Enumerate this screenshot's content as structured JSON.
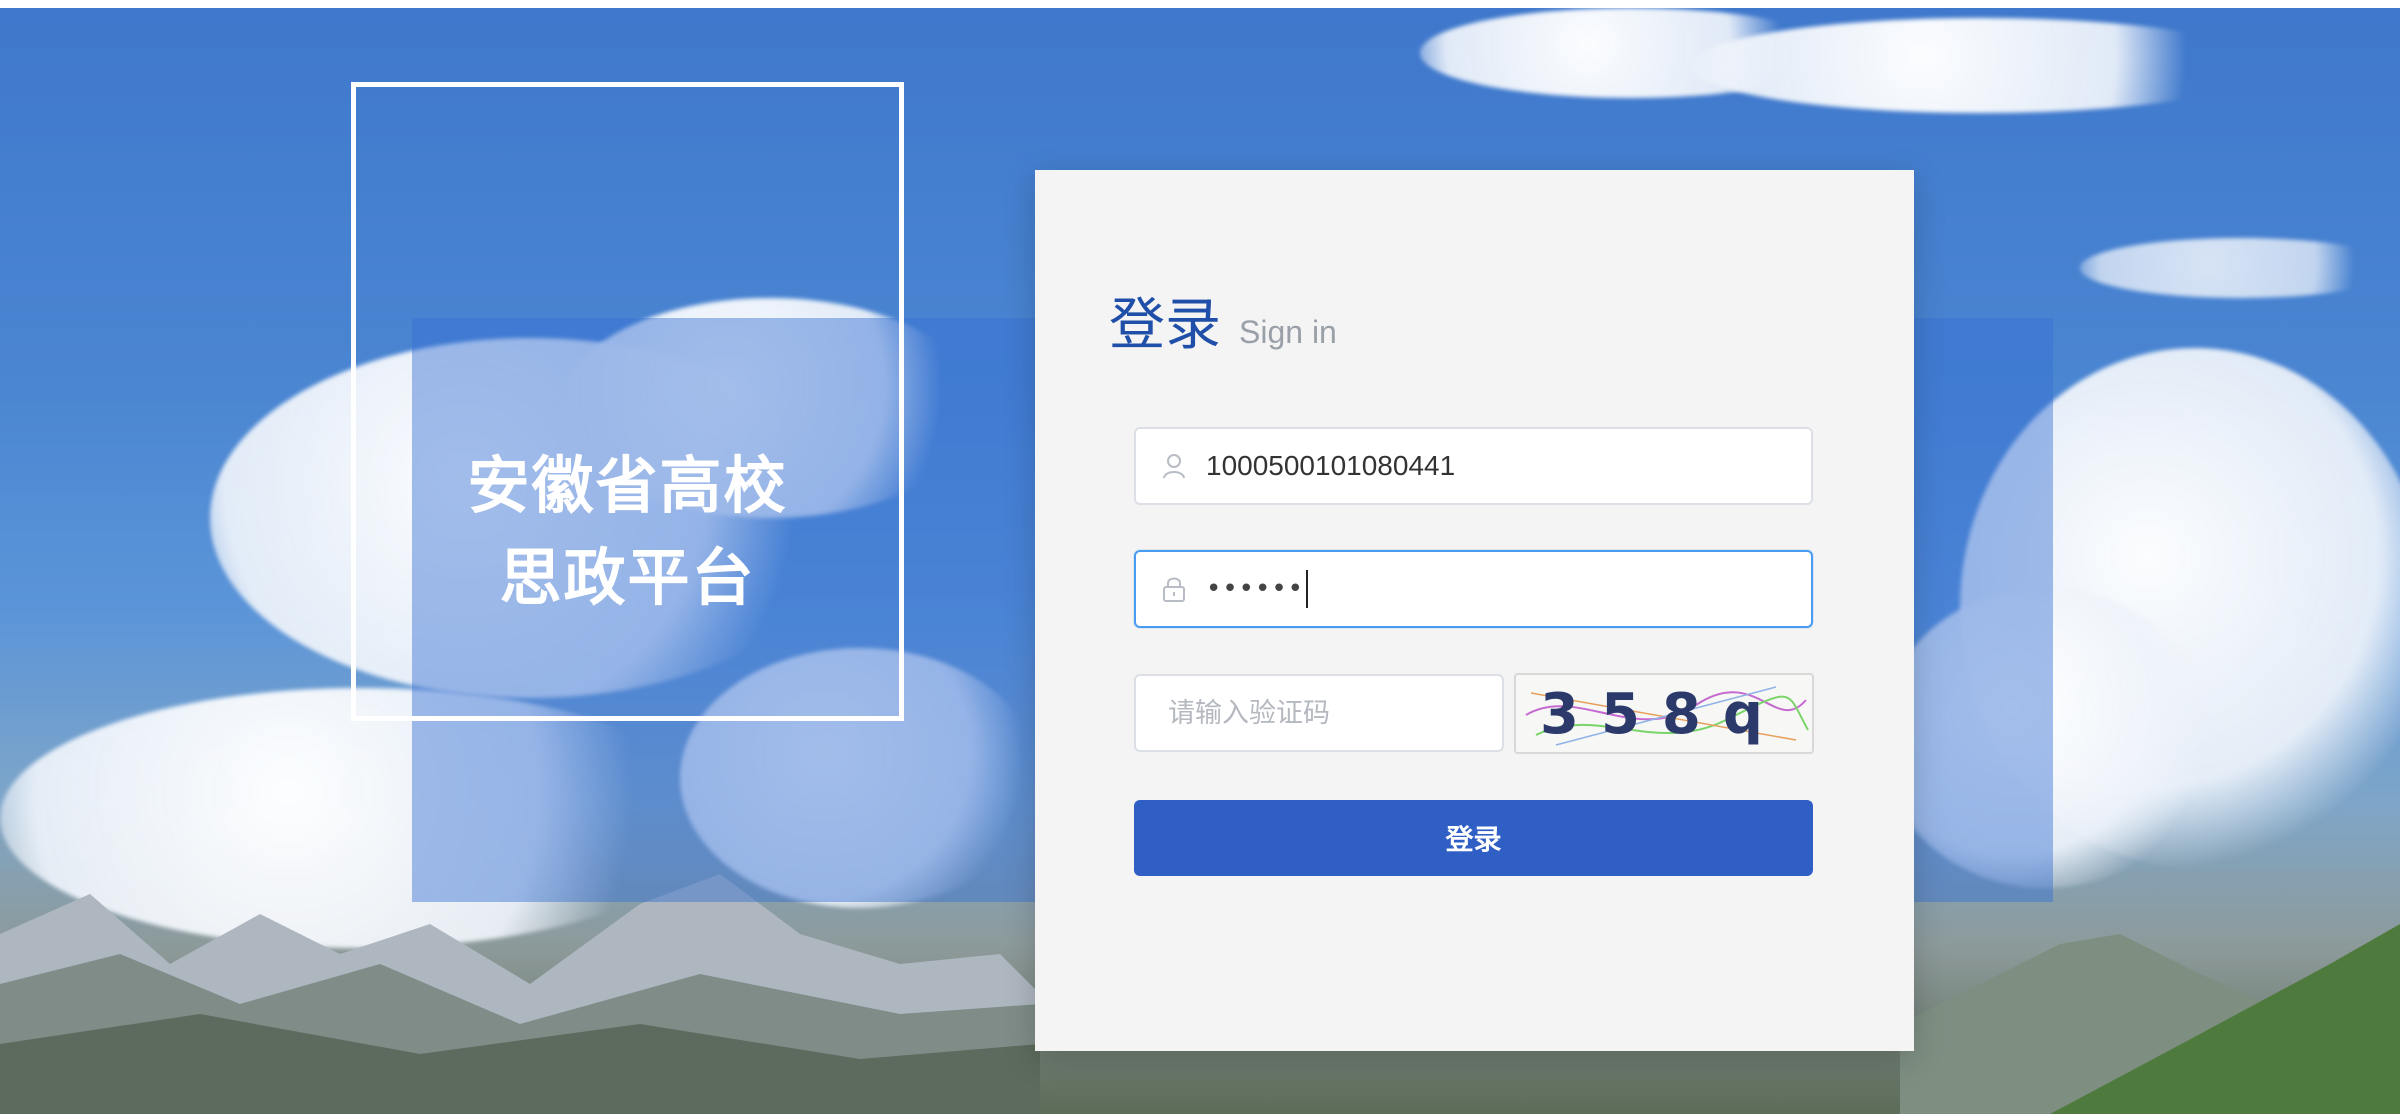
{
  "brand": {
    "line1": "安徽省高校",
    "line2": "思政平台"
  },
  "login": {
    "title": "登录",
    "subtitle": "Sign in",
    "username": {
      "value": "1000500101080441",
      "icon": "user-icon"
    },
    "password": {
      "masked_value": "••••••",
      "icon": "lock-icon"
    },
    "captcha": {
      "placeholder": "请输入验证码",
      "image_text": "358q"
    },
    "submit_label": "登录"
  },
  "colors": {
    "accent": "#2f5ec5",
    "focus_border": "#4a9cf0",
    "title_blue": "#1f4fa8"
  }
}
